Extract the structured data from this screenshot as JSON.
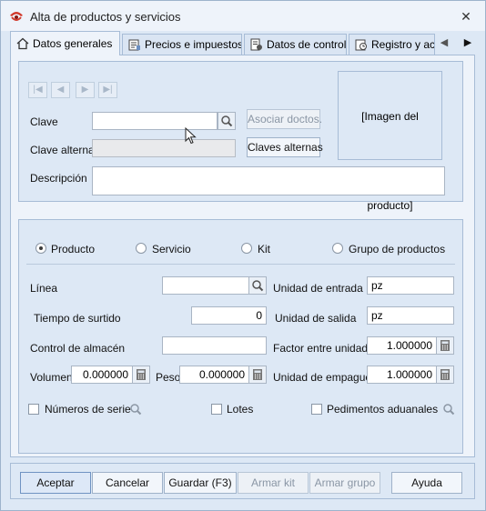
{
  "window": {
    "title": "Alta de productos y servicios",
    "close_glyph": "✕"
  },
  "tabs": [
    {
      "label": "Datos generales",
      "icon": "home-icon",
      "active": true
    },
    {
      "label": "Precios e impuestos",
      "icon": "price-tag-icon",
      "active": false
    },
    {
      "label": "Datos de control",
      "icon": "control-data-icon",
      "active": false
    },
    {
      "label": "Registro y ac",
      "icon": "registry-icon",
      "active": false
    }
  ],
  "tab_scroll": {
    "left": "◀",
    "right": "▶"
  },
  "record_nav": {
    "first": "|◀",
    "prev": "◀",
    "next": "▶",
    "last": "▶|"
  },
  "general": {
    "clave_label": "Clave",
    "clave_value": "",
    "asociar_button": "Asociar doctos.",
    "clave_alterna_label": "Clave alterna",
    "clave_alterna_value": "",
    "claves_alternas_button": "Claves alternas",
    "descripcion_label": "Descripción",
    "descripcion_value": "",
    "image_placeholder": "[Imagen del producto]"
  },
  "type_options": [
    {
      "label": "Producto",
      "checked": true
    },
    {
      "label": "Servicio",
      "checked": false
    },
    {
      "label": "Kit",
      "checked": false
    },
    {
      "label": "Grupo de productos",
      "checked": false
    }
  ],
  "details": {
    "linea_label": "Línea",
    "linea_value": "",
    "tiempo_label": "Tiempo de surtido",
    "tiempo_value": "0",
    "control_label": "Control de almacén",
    "control_value": "",
    "volumen_label": "Volumen",
    "volumen_value": "0.000000",
    "peso_label": "Peso",
    "peso_value": "0.000000",
    "unidad_entrada_label": "Unidad de entrada",
    "unidad_entrada_value": "pz",
    "unidad_salida_label": "Unidad de salida",
    "unidad_salida_value": "pz",
    "factor_label": "Factor entre unidades",
    "factor_value": "1.000000",
    "unidad_empaque_label": "Unidad de empague",
    "unidad_empaque_value": "1.000000"
  },
  "options": [
    {
      "label": "Números de serie",
      "checked": false
    },
    {
      "label": "Lotes",
      "checked": false
    },
    {
      "label": "Pedimentos aduanales",
      "checked": false
    }
  ],
  "footer": {
    "aceptar": "Aceptar",
    "cancelar": "Cancelar",
    "guardar": "Guardar (F3)",
    "armar_kit": "Armar kit",
    "armar_grupo": "Armar grupo",
    "ayuda": "Ayuda"
  },
  "colors": {
    "window_bg": "#dde8f5",
    "panel_bg": "#eef3fa",
    "border": "#a7bcd6",
    "accent": "#6f93c2"
  }
}
